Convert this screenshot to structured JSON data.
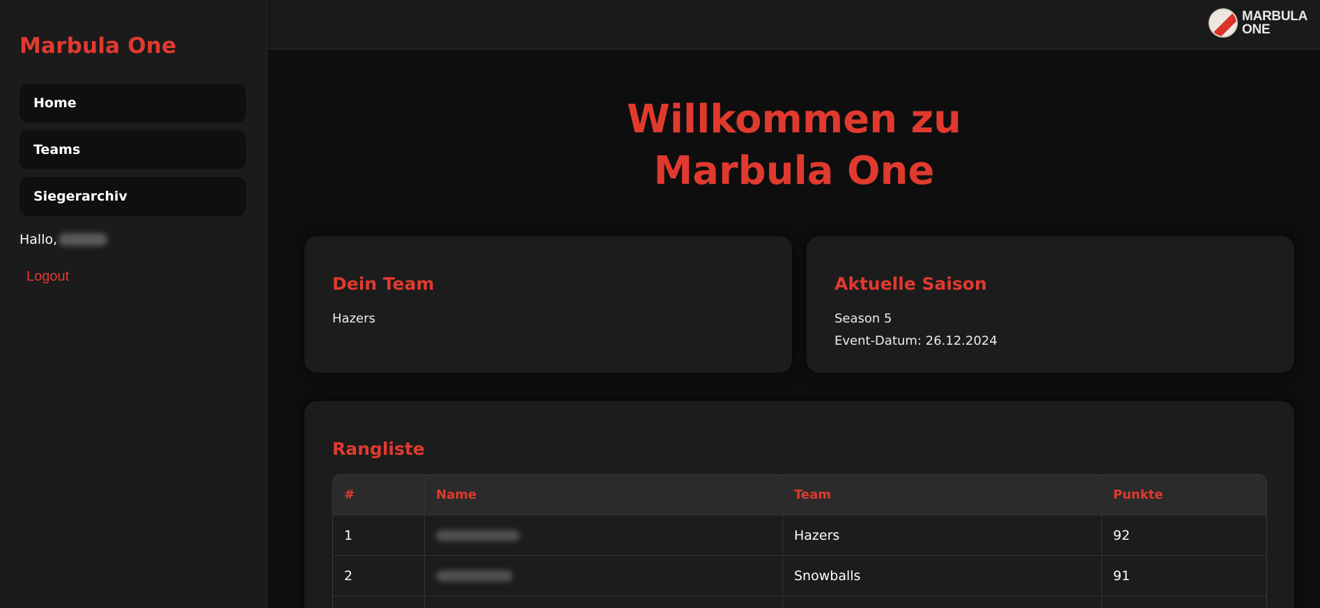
{
  "sidebar": {
    "brand": "Marbula One",
    "nav": [
      {
        "label": "Home"
      },
      {
        "label": "Teams"
      },
      {
        "label": "Siegerarchiv"
      }
    ],
    "greeting": "Hallo,",
    "logout": "Logout"
  },
  "topbar": {
    "logo_line1": "MARBULA",
    "logo_line2": "ONE"
  },
  "hero": {
    "line1": "Willkommen zu",
    "line2": "Marbula One"
  },
  "team_card": {
    "title": "Dein Team",
    "team": "Hazers"
  },
  "season_card": {
    "title": "Aktuelle Saison",
    "season": "Season 5",
    "event_date": "Event-Datum: 26.12.2024"
  },
  "ranking": {
    "title": "Rangliste",
    "columns": [
      "#",
      "Name",
      "Team",
      "Punkte"
    ],
    "rows": [
      {
        "rank": "1",
        "team": "Hazers",
        "points": "92"
      },
      {
        "rank": "2",
        "team": "Snowballs",
        "points": "91"
      }
    ]
  },
  "colors": {
    "accent": "#e03a2f",
    "background": "#0e0e0e",
    "sidebar": "#1b1b1b",
    "card": "#1c1c1c"
  }
}
